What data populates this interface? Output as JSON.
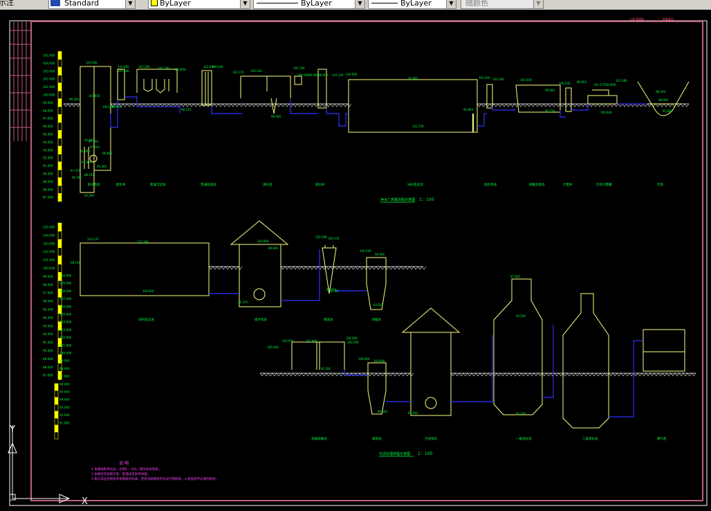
{
  "toolbar": {
    "text_style_label_fragment": "示注",
    "text_style_value": "Standard",
    "color_value": "ByLayer",
    "linetype_value": "ByLayer",
    "lineweight_value": "ByLayer",
    "plotstyle_value": "随颜色"
  },
  "drawing": {
    "top_right_label": "工程 管理处",
    "top_right_label_2": "审查意见",
    "upper_profile_title": "净水厂高程流程示意图",
    "upper_profile_scale": "1：100",
    "lower_profile_title": "污泥处理高程示意图",
    "lower_profile_scale": "1：100",
    "ruler_upper": [
      "105.000",
      "104.000",
      "103.000",
      "102.000",
      "101.000",
      "100.000",
      "99.000",
      "98.000",
      "97.000",
      "96.000",
      "95.000",
      "94.000",
      "93.000",
      "92.000",
      "91.000",
      "90.000",
      "89.000",
      "88.000",
      "87.000"
    ],
    "ruler_lower_left": [
      "105.000",
      "104.000",
      "103.000",
      "102.000",
      "101.000",
      "100.000",
      "99.000",
      "98.000",
      "97.000",
      "96.000",
      "95.000",
      "94.000",
      "93.000",
      "92.000",
      "91.000",
      "90.000",
      "89.000",
      "88.000",
      "87.000"
    ],
    "ruler_lower_right": [
      "110.000",
      "109.000",
      "108.000",
      "107.000",
      "106.000",
      "105.000",
      "104.000",
      "103.000",
      "102.000",
      "101.000",
      "100.000",
      "99.000",
      "98.000",
      "97.000",
      "96.000",
      "95.000",
      "94.000",
      "93.000",
      "92.000",
      "91.000"
    ],
    "upper_units": [
      "取水泵房",
      "配水井",
      "絮凝沉淀池",
      "普通快滤池",
      "清水池",
      "吸水井",
      "SBR反应池",
      "提升泵站",
      "接触消毒池",
      "计量井",
      "巴氏计量槽",
      "河道"
    ],
    "lower_units_row1": [
      "SBR反应池",
      "提升泵房",
      "储泥池",
      "浓缩池"
    ],
    "lower_units_row2": [
      "机械浓缩池",
      "储泥池",
      "污泥泵房",
      "一级消化池",
      "二级消化池",
      "储气柜"
    ],
    "elevations_upper": [
      "103.500",
      "102.800",
      "101.500",
      "103.200",
      "102.100",
      "100.850",
      "99.300",
      "101.850",
      "100.500",
      "99.900",
      "102.600",
      "100.500",
      "98.370",
      "97.100",
      "96.850",
      "102.170",
      "100.120",
      "99.500",
      "97.375",
      "101.700",
      "100.500",
      "99.400",
      "98.850",
      "101.320",
      "100.900",
      "97.800",
      "95.800",
      "101.750",
      "101.450",
      "101.200",
      "100.500",
      "99.600",
      "97.150",
      "100.500",
      "99.850",
      "101.277",
      "100.800",
      "101.380",
      "100.600",
      "98.500",
      "98.900",
      "95.800",
      "93.800",
      "91.000",
      "91.900",
      "95.500",
      "88.100",
      "92.200",
      "90.700",
      "87.100"
    ],
    "elevations_lower": [
      "103.270",
      "102.300",
      "100.000",
      "95.370",
      "98.750",
      "102.800",
      "99.800",
      "94.950",
      "102.580",
      "100.170",
      "93.301",
      "100.500",
      "99.400",
      "93.025",
      "102.900",
      "102.400",
      "100.400",
      "92.500",
      "106.000",
      "102.000",
      "87.000",
      "106.600",
      "103.600",
      "88.060",
      "97.000",
      "95.556",
      "93.700"
    ],
    "notes_title": "说 明",
    "notes": [
      "1 本图高程单位米，比例1：100，相对标高系统。",
      "2 本图仅作高程示意，管道详见各单体图。",
      "3 施工前应对照各单体图核对标高，若有问题请及时与设计院联系，以免造成不必要的损失。"
    ],
    "ucs_y": "Y",
    "ucs_x": "X"
  }
}
